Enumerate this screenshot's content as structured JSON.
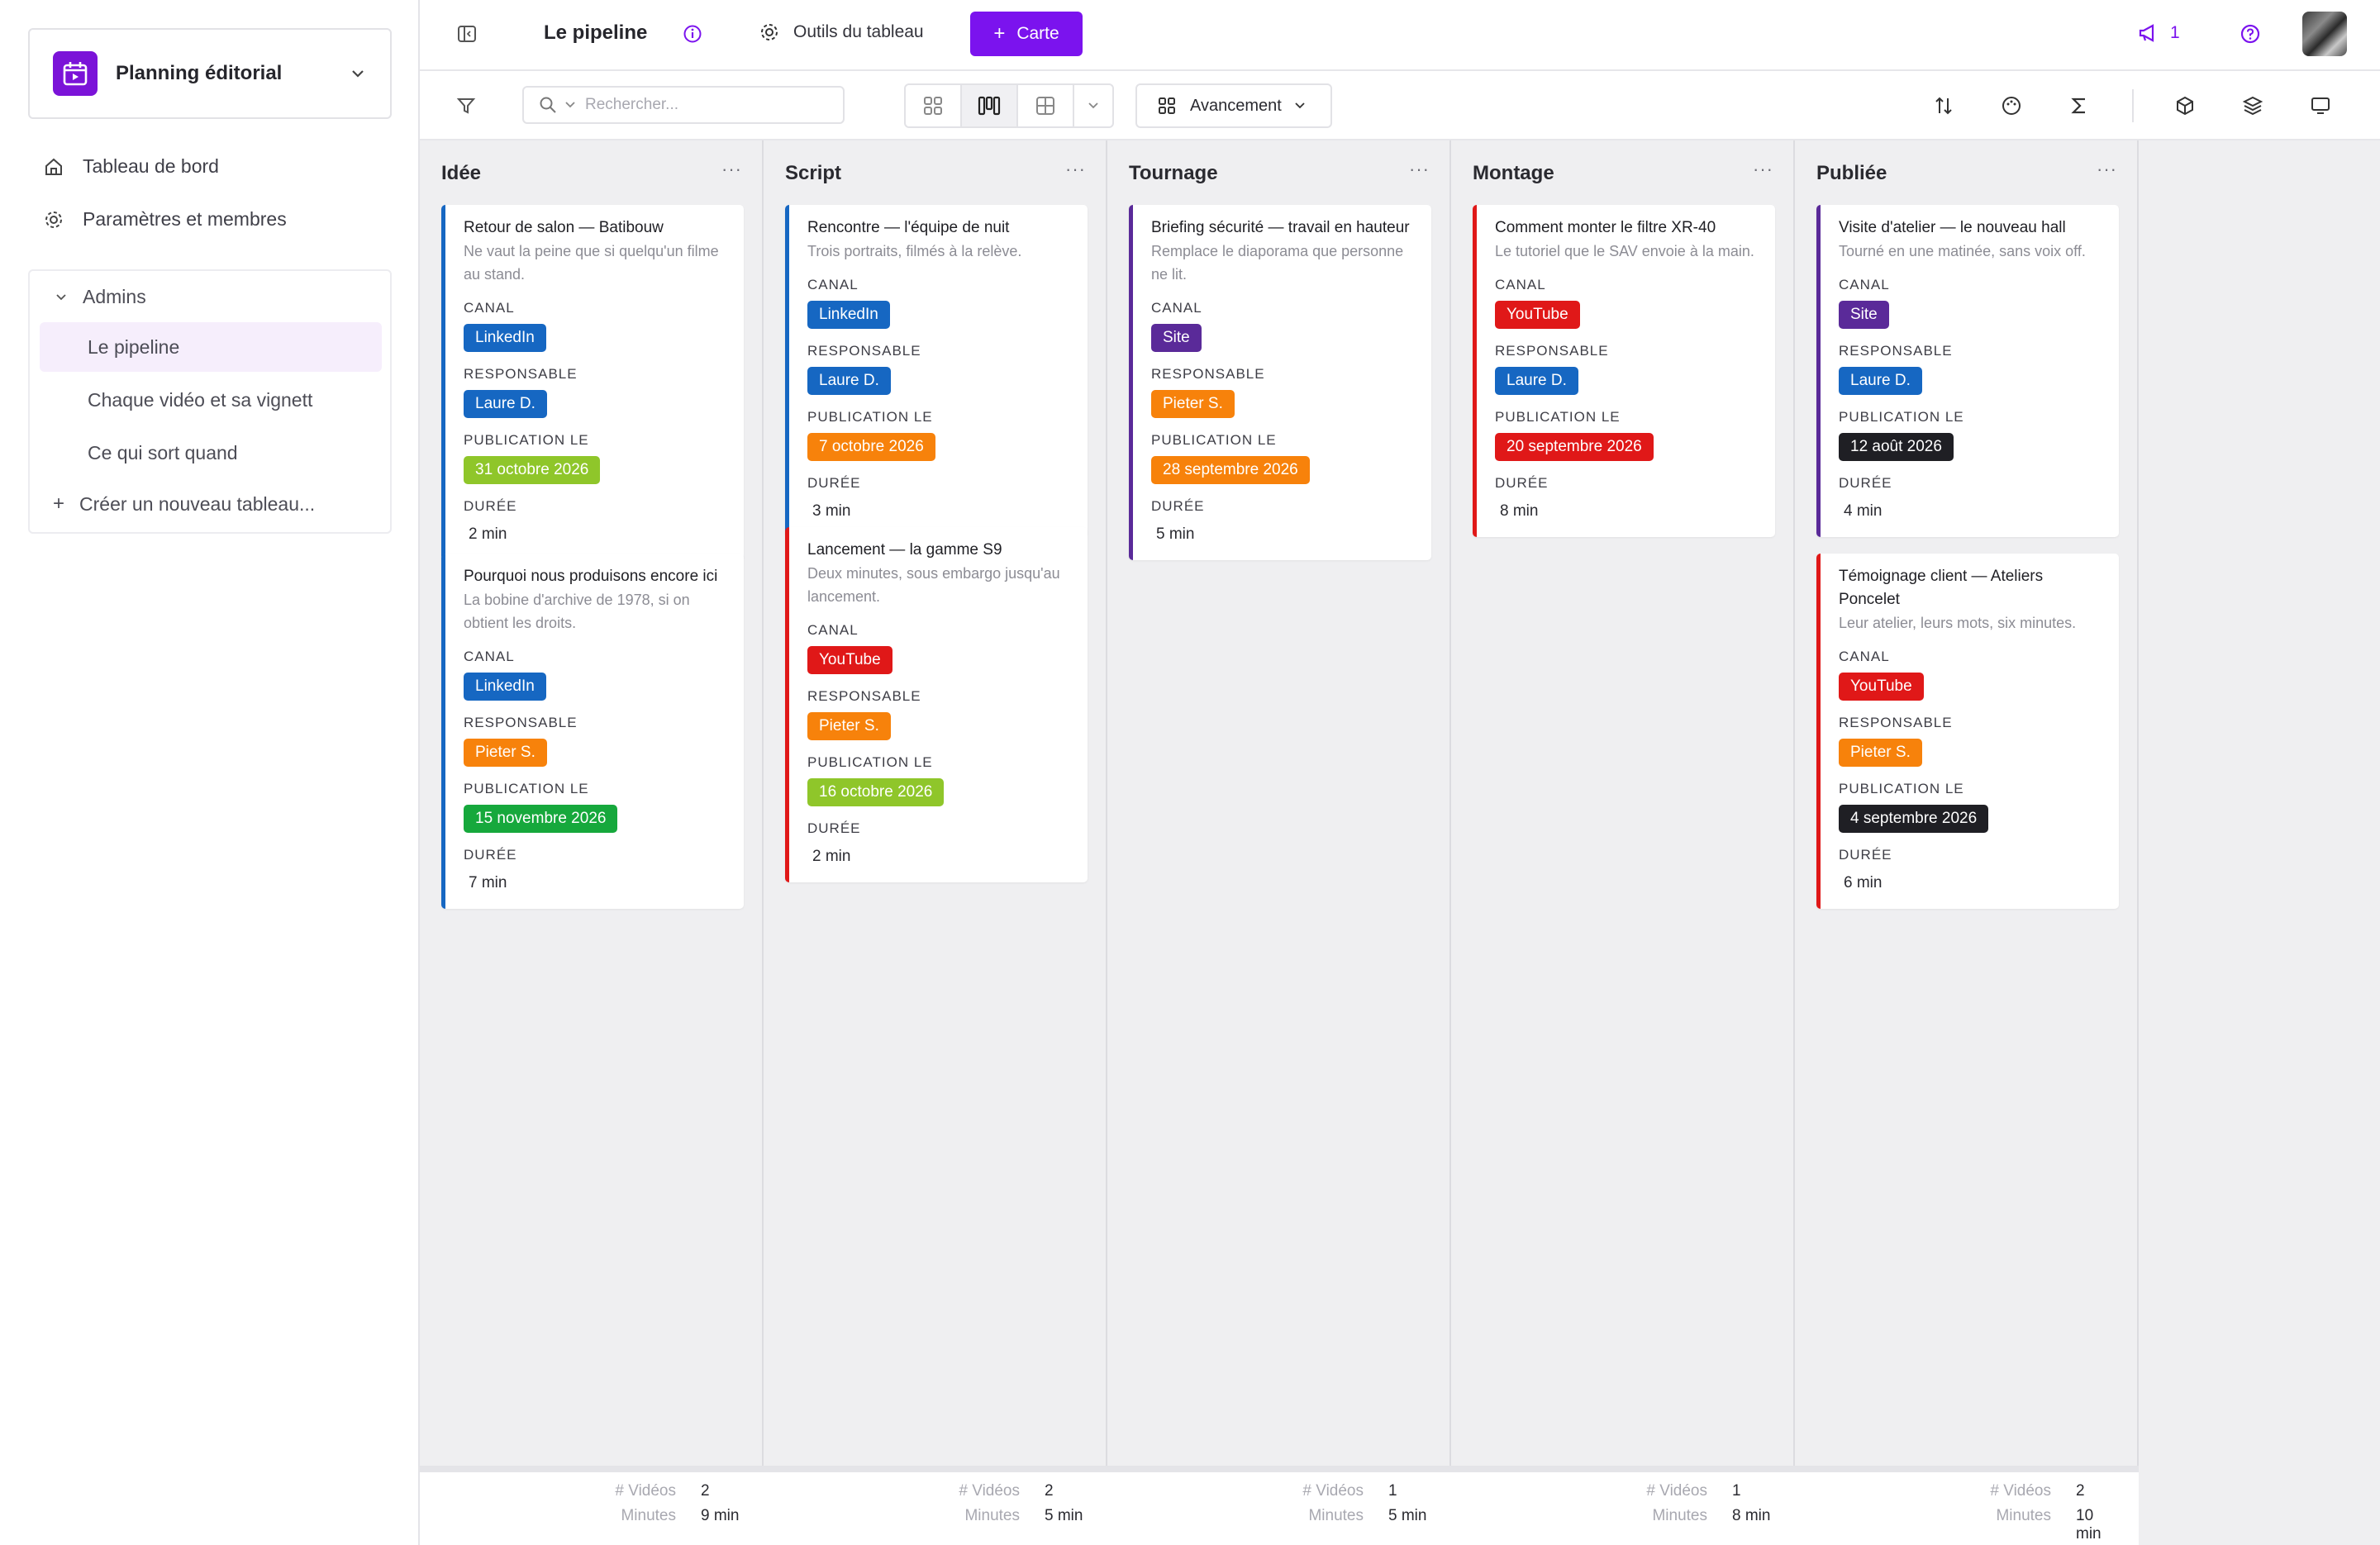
{
  "workspace": {
    "name": "Planning éditorial"
  },
  "sidebar": {
    "links": [
      {
        "label": "Tableau de bord",
        "icon": "home-icon"
      },
      {
        "label": "Paramètres et membres",
        "icon": "gear-icon"
      }
    ],
    "group": {
      "name": "Admins",
      "boards": [
        "Le pipeline",
        "Chaque vidéo et sa vignett",
        "Ce qui sort quand"
      ],
      "active_index": 0,
      "create_label": "Créer un nouveau tableau..."
    }
  },
  "topbar": {
    "board_title": "Le pipeline",
    "tools_label": "Outils du tableau",
    "add_card_label": "Carte",
    "notif_count": "1",
    "accent": "#7b13ee"
  },
  "toolbar": {
    "search_placeholder": "Rechercher...",
    "group_by_label": "Avancement"
  },
  "field_labels": {
    "canal": "CANAL",
    "responsable": "RESPONSABLE",
    "publication": "PUBLICATION LE",
    "duree": "DURÉE"
  },
  "footer_labels": {
    "videos": "# Vidéos",
    "minutes": "Minutes"
  },
  "columns": [
    {
      "title": "Idée",
      "more": "···",
      "footer": {
        "videos": "2",
        "minutes": "9 min"
      },
      "cards": [
        {
          "title": "Retour de salon — Batibouw",
          "desc": "Ne vaut la peine que si quelqu'un filme au stand.",
          "canal": "LinkedIn",
          "resp": "Laure D.",
          "date": "31 octobre 2026",
          "duree": "2 min"
        },
        {
          "title": "Pourquoi nous produisons encore ici",
          "desc": "La bobine d'archive de 1978, si on obtient les droits.",
          "canal": "LinkedIn",
          "resp": "Pieter S.",
          "date": "15 novembre 2026",
          "duree": "7 min"
        }
      ]
    },
    {
      "title": "Script",
      "more": "···",
      "footer": {
        "videos": "2",
        "minutes": "5 min"
      },
      "cards": [
        {
          "title": "Rencontre — l'équipe de nuit",
          "desc": "Trois portraits, filmés à la relève.",
          "canal": "LinkedIn",
          "resp": "Laure D.",
          "date": "7 octobre 2026",
          "duree": "3 min"
        },
        {
          "title": "Lancement — la gamme S9",
          "desc": "Deux minutes, sous embargo jusqu'au lancement.",
          "canal": "YouTube",
          "resp": "Pieter S.",
          "date": "16 octobre 2026",
          "duree": "2 min"
        }
      ]
    },
    {
      "title": "Tournage",
      "more": "···",
      "footer": {
        "videos": "1",
        "minutes": "5 min"
      },
      "cards": [
        {
          "title": "Briefing sécurité — travail en hauteur",
          "desc": "Remplace le diaporama que personne ne lit.",
          "canal": "Site",
          "resp": "Pieter S.",
          "date": "28 septembre 2026",
          "duree": "5 min"
        }
      ]
    },
    {
      "title": "Montage",
      "more": "···",
      "footer": {
        "videos": "1",
        "minutes": "8 min"
      },
      "cards": [
        {
          "title": "Comment monter le filtre XR-40",
          "desc": "Le tutoriel que le SAV envoie à la main.",
          "canal": "YouTube",
          "resp": "Laure D.",
          "date": "20 septembre 2026",
          "duree": "8 min"
        }
      ]
    },
    {
      "title": "Publiée",
      "more": "···",
      "footer": {
        "videos": "2",
        "minutes": "10 min"
      },
      "cards": [
        {
          "title": "Visite d'atelier — le nouveau hall",
          "desc": "Tourné en une matinée, sans voix off.",
          "canal": "Site",
          "resp": "Laure D.",
          "date": "12 août 2026",
          "duree": "4 min"
        },
        {
          "title": "Témoignage client — Ateliers Poncelet",
          "desc": "Leur atelier, leurs mots, six minutes.",
          "canal": "YouTube",
          "resp": "Pieter S.",
          "date": "4 septembre 2026",
          "duree": "6 min"
        }
      ]
    }
  ]
}
